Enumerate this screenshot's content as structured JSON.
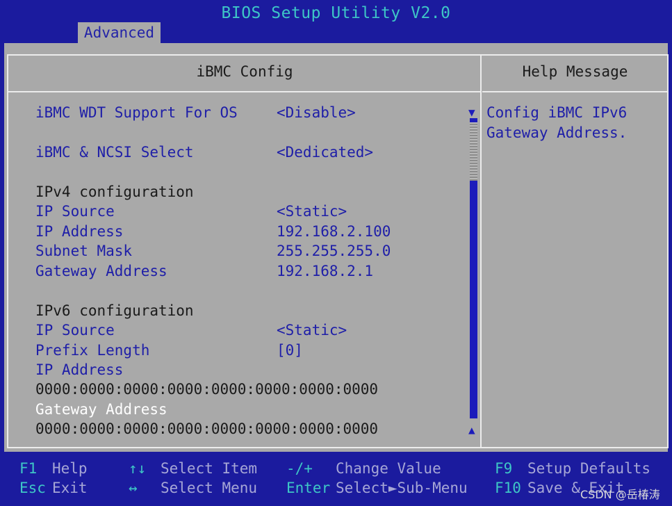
{
  "title": "BIOS Setup Utility V2.0",
  "tabs": [
    {
      "label": "Advanced"
    }
  ],
  "main": {
    "header": "iBMC Config",
    "rows": [
      {
        "label": "iBMC WDT Support For OS",
        "value": "<Disable>"
      },
      {
        "label": "iBMC & NCSI Select",
        "value": "<Dedicated>"
      }
    ],
    "ipv4": {
      "title": "IPv4 configuration",
      "rows": [
        {
          "label": "IP Source",
          "value": "<Static>"
        },
        {
          "label": "IP Address",
          "value": "192.168.2.100"
        },
        {
          "label": "Subnet Mask",
          "value": "255.255.255.0"
        },
        {
          "label": "Gateway Address",
          "value": "192.168.2.1"
        }
      ]
    },
    "ipv6": {
      "title": "IPv6 configuration",
      "rows": [
        {
          "label": "IP Source",
          "value": "<Static>"
        },
        {
          "label": "Prefix Length",
          "value": "[0]"
        }
      ],
      "ip_address_label": "IP Address",
      "ip_address_value": "0000:0000:0000:0000:0000:0000:0000:0000",
      "gateway_label": "Gateway Address",
      "gateway_value": "0000:0000:0000:0000:0000:0000:0000:0000"
    }
  },
  "help": {
    "header": "Help Message",
    "text": "Config iBMC IPv6\nGateway Address."
  },
  "footer": [
    {
      "key": "F1",
      "desc": "Help"
    },
    {
      "key": "Esc",
      "desc": "Exit"
    },
    {
      "key": "↑↓",
      "desc": "Select Item"
    },
    {
      "key": "↔",
      "desc": "Select Menu"
    },
    {
      "key": "-/+",
      "desc": "Change Value"
    },
    {
      "key": "Enter",
      "desc": "Select►Sub-Menu"
    },
    {
      "key": "F9",
      "desc": "Setup Defaults"
    },
    {
      "key": "F10",
      "desc": "Save & Exit"
    }
  ],
  "watermark": "CSDN @岳椿涛",
  "colors": {
    "background": "#1b1b9e",
    "panel": "#a9a9a9",
    "accent": "#3ec6c6",
    "item_text": "#1e1ea8",
    "selected_text": "#ffffff"
  }
}
